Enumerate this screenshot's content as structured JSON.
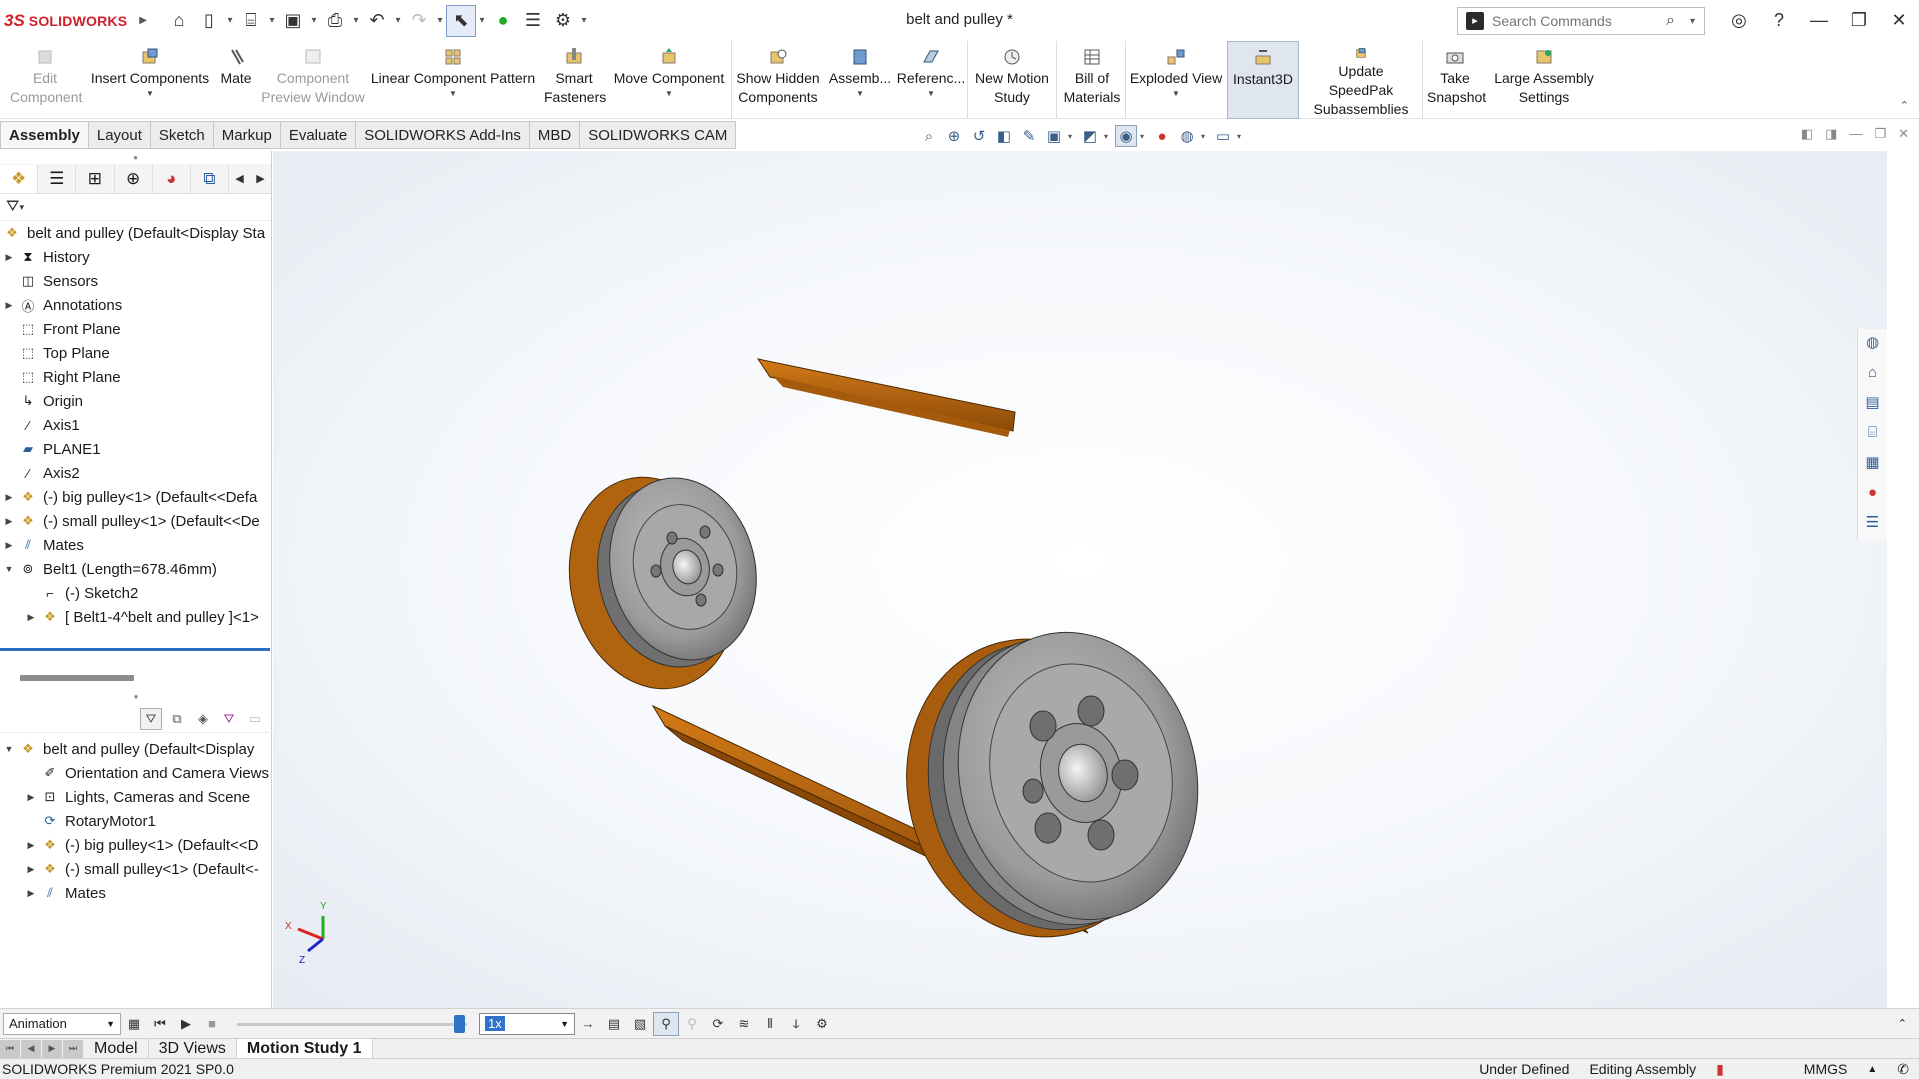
{
  "app": {
    "logo_ds": "3S",
    "logo_name": "SOLIDWORKS",
    "document_title": "belt and pulley *"
  },
  "search": {
    "placeholder": "Search Commands"
  },
  "command_manager": {
    "edit_component": "Edit Component",
    "insert_components": "Insert Components",
    "mate": "Mate",
    "component_preview": "Component Preview Window",
    "linear_pattern": "Linear Component Pattern",
    "smart_fasteners": "Smart Fasteners",
    "move_component": "Move Component",
    "show_hidden": "Show Hidden Components",
    "assembly_features": "Assemb...",
    "reference_geometry": "Referenc...",
    "new_motion_study": "New Motion Study",
    "bill_of_materials": "Bill of Materials",
    "exploded_view": "Exploded View",
    "instant3d": "Instant3D",
    "update_speedpak": "Update SpeedPak Subassemblies",
    "take_snapshot": "Take Snapshot",
    "large_assembly": "Large Assembly Settings"
  },
  "tabs": [
    "Assembly",
    "Layout",
    "Sketch",
    "Markup",
    "Evaluate",
    "SOLIDWORKS Add-Ins",
    "MBD",
    "SOLIDWORKS CAM"
  ],
  "feature_tree": {
    "root": "belt and pulley  (Default<Display Sta",
    "history": "History",
    "sensors": "Sensors",
    "annotations": "Annotations",
    "front_plane": "Front Plane",
    "top_plane": "Top Plane",
    "right_plane": "Right Plane",
    "origin": "Origin",
    "axis1": "Axis1",
    "plane1": "PLANE1",
    "axis2": "Axis2",
    "big_pulley": "(-) big pulley<1> (Default<<Defa",
    "small_pulley": "(-) small pulley<1> (Default<<De",
    "mates": "Mates",
    "belt1": "Belt1 (Length=678.46mm)",
    "sketch2": "(-) Sketch2",
    "belt_part": "[ Belt1-4^belt and pulley ]<1>"
  },
  "motion_tree": {
    "root": "belt and pulley  (Default<Display",
    "orientation": "Orientation and Camera Views",
    "lights": "Lights, Cameras and Scene",
    "rotary_motor": "RotaryMotor1",
    "big_pulley": "(-) big pulley<1> (Default<<D",
    "small_pulley": "(-) small pulley<1> (Default<-",
    "mates": "Mates"
  },
  "motion_manager": {
    "study_type": "Animation",
    "speed": "1x"
  },
  "triad": {
    "x": "X",
    "y": "Y",
    "z": "Z"
  },
  "bottom_tabs": [
    "Model",
    "3D Views",
    "Motion Study 1"
  ],
  "status": {
    "product": "SOLIDWORKS Premium 2021 SP0.0",
    "definition": "Under Defined",
    "mode": "Editing Assembly",
    "units": "MMGS"
  },
  "colors": {
    "belt": "#c06a0e",
    "pulley": "#9a9a9a",
    "accent": "#2f72c9"
  }
}
